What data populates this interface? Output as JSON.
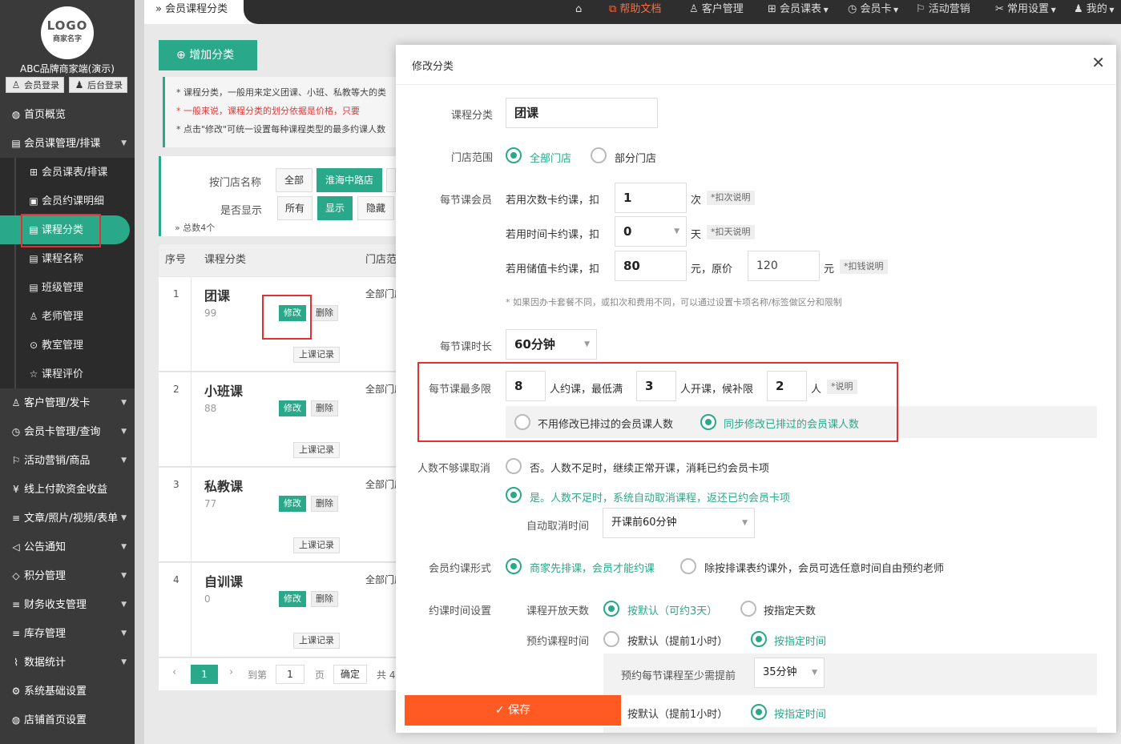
{
  "colors": {
    "accent": "#2aa98a",
    "sidebar": "#3a3a3a",
    "save": "#ff5a22",
    "highlight": "#e43030"
  },
  "sidebar": {
    "logo_title": "LOGO",
    "logo_sub": "商家名字",
    "brand": "ABC品牌商家端(演示)",
    "member_login": "会员登录",
    "admin_login": "后台登录",
    "items": [
      {
        "label": "首页概览",
        "icon": "globe-icon"
      },
      {
        "label": "会员课管理/排课",
        "icon": "book-icon"
      },
      {
        "label": "客户管理/发卡",
        "icon": "user-icon"
      },
      {
        "label": "会员卡管理/查询",
        "icon": "clock-icon"
      },
      {
        "label": "活动营销/商品",
        "icon": "flag-icon"
      },
      {
        "label": "线上付款资金收益",
        "icon": "money-icon"
      },
      {
        "label": "文章/照片/视频/表单",
        "icon": "sliders-icon"
      },
      {
        "label": "公告通知",
        "icon": "speaker-icon"
      },
      {
        "label": "积分管理",
        "icon": "diamond-icon"
      },
      {
        "label": "财务收支管理",
        "icon": "sliders-icon"
      },
      {
        "label": "库存管理",
        "icon": "sliders-icon"
      },
      {
        "label": "数据统计",
        "icon": "chart-icon"
      },
      {
        "label": "系统基础设置",
        "icon": "gear-icon"
      },
      {
        "label": "店铺首页设置",
        "icon": "globe-icon"
      }
    ],
    "sub_items": [
      {
        "label": "会员课表/排课"
      },
      {
        "label": "会员约课明细"
      },
      {
        "label": "课程分类"
      },
      {
        "label": "课程名称"
      },
      {
        "label": "班级管理"
      },
      {
        "label": "老师管理"
      },
      {
        "label": "教室管理"
      },
      {
        "label": "课程评价"
      }
    ]
  },
  "topbar": {
    "breadcrumb": "会员课程分类",
    "help": "帮助文档",
    "customers": "客户管理",
    "schedule": "会员课表",
    "card": "会员卡",
    "marketing": "活动营销",
    "settings": "常用设置",
    "mine": "我的"
  },
  "page": {
    "add_button": "增加分类",
    "tips": [
      "* 课程分类，一般用来定义团课、小班、私教等大的类",
      "* 一般来说，课程分类的划分依据是价格，只要",
      "* 点击\"修改\"可统一设置每种课程类型的最多约课人数"
    ],
    "filter_shop_label": "按门店名称",
    "filter_all": "全部",
    "filter_shop": "淮海中路店",
    "filter_show_label": "是否显示",
    "show_all": "所有",
    "show_yes": "显示",
    "show_no": "隐藏",
    "total": "总数4个",
    "col_no": "序号",
    "col_cat": "课程分类",
    "col_shop": "门店范",
    "edit": "修改",
    "delete": "删除",
    "records": "上课记录",
    "rows": [
      {
        "no": "1",
        "name": "团课",
        "count": "99",
        "shop": "全部门店"
      },
      {
        "no": "2",
        "name": "小班课",
        "count": "88",
        "shop": "全部门店"
      },
      {
        "no": "3",
        "name": "私教课",
        "count": "77",
        "shop": "全部门店"
      },
      {
        "no": "4",
        "name": "自训课",
        "count": "0",
        "shop": "全部门店"
      }
    ],
    "pager": {
      "current": "1",
      "goto": "到第",
      "page_input": "1",
      "page_unit": "页",
      "confirm": "确定",
      "total": "共 4"
    }
  },
  "modal": {
    "title": "修改分类",
    "category_label": "课程分类",
    "category_value": "团课",
    "scope_label": "门店范围",
    "scope_all": "全部门店",
    "scope_part": "部分门店",
    "member_label": "每节课会员",
    "times_text": "若用次数卡约课，扣",
    "times_value": "1",
    "times_unit": "次",
    "times_note": "*扣次说明",
    "time_text": "若用时间卡约课，扣",
    "time_value": "0",
    "time_unit": "天",
    "time_note": "*扣天说明",
    "value_text": "若用储值卡约课，扣",
    "value_value": "80",
    "value_unit": "元，原价",
    "value_orig": "120",
    "value_unit2": "元",
    "value_note": "*扣钱说明",
    "hint": "* 如果因办卡套餐不同，或扣次和费用不同，可以通过设置卡项名称/标签做区分和限制",
    "duration_label": "每节课时长",
    "duration_value": "60分钟",
    "limit_label": "每节课最多限",
    "limit_max": "8",
    "limit_t1": "人约课，最低满",
    "limit_min": "3",
    "limit_t2": "人开课，候补限",
    "limit_wait": "2",
    "limit_t3": "人",
    "limit_note": "*说明",
    "sync_no": "不用修改已排过的会员课人数",
    "sync_yes": "同步修改已排过的会员课人数",
    "cancel_label": "人数不够课取消",
    "cancel_no": "否。人数不足时，继续正常开课，消耗已约会员卡项",
    "cancel_yes": "是。人数不足时，系统自动取消课程，返还已约会员卡项",
    "auto_cancel_label": "自动取消时间",
    "auto_cancel_value": "开课前60分钟",
    "mode_label": "会员约课形式",
    "mode_a": "商家先排课，会员才能约课",
    "mode_b": "除按排课表约课外，会员可选任意时间自由预约老师",
    "time_setting_label": "约课时间设置",
    "open_days_label": "课程开放天数",
    "open_default": "按默认（可约3天）",
    "open_custom": "按指定天数",
    "book_time_label": "预约课程时间",
    "book_default": "按默认（提前1小时）",
    "book_custom": "按指定时间",
    "advance_label": "预约每节课程至少需提前",
    "advance_value": "35分钟",
    "row2_default": "按默认（提前1小时）",
    "row2_custom": "按指定时间",
    "save": "保存"
  }
}
